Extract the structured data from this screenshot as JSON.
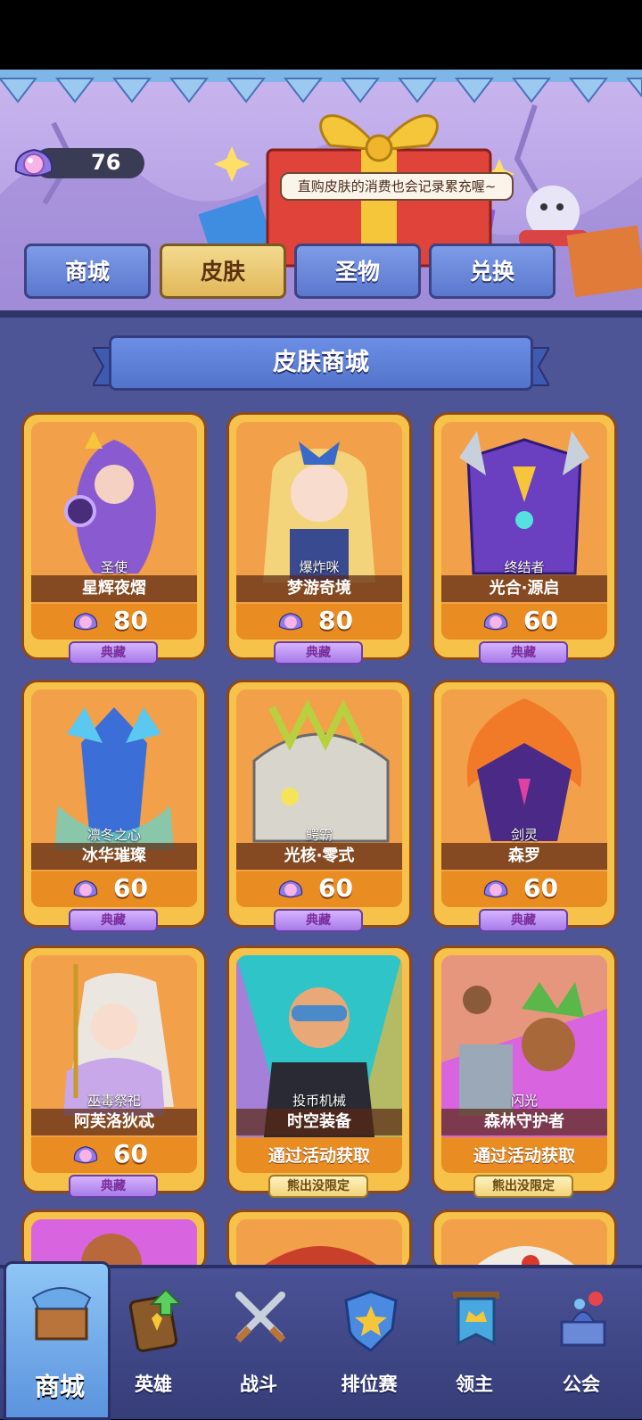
{
  "currency": {
    "amount": "76",
    "icon": "pearl-gem-icon"
  },
  "banner": {
    "tip": "直购皮肤的消费也会记录累充喔~"
  },
  "tabs": [
    {
      "label": "商城",
      "active": false
    },
    {
      "label": "皮肤",
      "active": true
    },
    {
      "label": "圣物",
      "active": false
    },
    {
      "label": "兑换",
      "active": false
    }
  ],
  "section": {
    "title": "皮肤商城"
  },
  "skins": [
    {
      "hero": "圣使",
      "name": "星辉夜熠",
      "price": "80",
      "badge": "典藏"
    },
    {
      "hero": "爆炸咪",
      "name": "梦游奇境",
      "price": "80",
      "badge": "典藏"
    },
    {
      "hero": "终结者",
      "name": "光合·源启",
      "price": "60",
      "badge": "典藏"
    },
    {
      "hero": "凛冬之心",
      "name": "冰华璀璨",
      "price": "60",
      "badge": "典藏"
    },
    {
      "hero": "鳄霸",
      "name": "光核·零式",
      "price": "60",
      "badge": "典藏"
    },
    {
      "hero": "剑灵",
      "name": "森罗",
      "price": "60",
      "badge": "典藏"
    },
    {
      "hero": "巫毒祭祀",
      "name": "阿芙洛狄忒",
      "price": "60",
      "badge": "典藏"
    },
    {
      "hero": "投币机械",
      "name": "时空装备",
      "obtain": "通过活动获取",
      "badge": "熊出没限定"
    },
    {
      "hero": "闪光",
      "name": "森林守护者",
      "obtain": "通过活动获取",
      "badge": "熊出没限定"
    }
  ],
  "nav": [
    {
      "label": "商城",
      "icon": "shop-chest-icon",
      "active": true
    },
    {
      "label": "英雄",
      "icon": "hero-card-icon",
      "active": false
    },
    {
      "label": "战斗",
      "icon": "crossed-swords-icon",
      "active": false
    },
    {
      "label": "排位赛",
      "icon": "ranked-shield-icon",
      "active": false
    },
    {
      "label": "领主",
      "icon": "lord-banner-icon",
      "active": false
    },
    {
      "label": "公会",
      "icon": "guild-castle-icon",
      "active": false
    }
  ],
  "colors": {
    "accent": "#f7c24a",
    "panel": "#4d5596",
    "tab_active": "#e1b85a",
    "tab": "#6b8ee4"
  }
}
